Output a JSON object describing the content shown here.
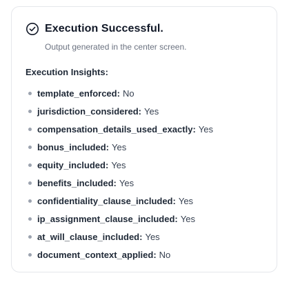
{
  "status": {
    "title": "Execution Successful.",
    "subtitle": "Output generated in the center screen.",
    "icon": "check-circle-icon"
  },
  "insights": {
    "heading": "Execution Insights:",
    "items": [
      {
        "key": "template_enforced",
        "value": "No"
      },
      {
        "key": "jurisdiction_considered",
        "value": "Yes"
      },
      {
        "key": "compensation_details_used_exactly",
        "value": "Yes"
      },
      {
        "key": "bonus_included",
        "value": "Yes"
      },
      {
        "key": "equity_included",
        "value": "Yes"
      },
      {
        "key": "benefits_included",
        "value": "Yes"
      },
      {
        "key": "confidentiality_clause_included",
        "value": "Yes"
      },
      {
        "key": "ip_assignment_clause_included",
        "value": "Yes"
      },
      {
        "key": "at_will_clause_included",
        "value": "Yes"
      },
      {
        "key": "document_context_applied",
        "value": "No"
      }
    ]
  },
  "colors": {
    "border": "#e5e7eb",
    "bullet": "#9ca3af",
    "muted_text": "#6b7280"
  }
}
